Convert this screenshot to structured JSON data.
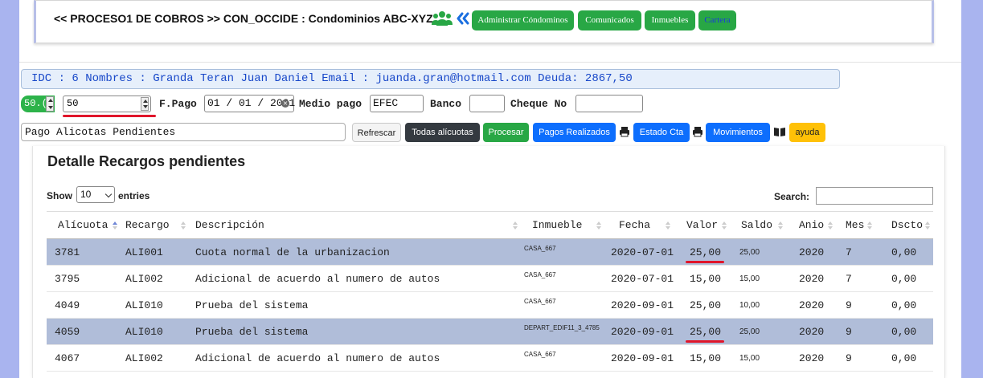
{
  "header": {
    "title": "<< PROCESO1 DE COBROS >> CON_OCCIDE : Condominios ABC-XYZ.",
    "buttons": [
      "Administrar Cóndominos",
      "Comunicados",
      "Inmuebles",
      "Cartera"
    ]
  },
  "info": {
    "text": "IDC : 6 Nombres : Granda Teran Juan Daniel Email : juanda.gran@hotmail.com Deuda: 2867,50"
  },
  "form": {
    "green_spin_value": "50.(",
    "amount_value": "50",
    "fpago_label": "F.Pago",
    "fpago_value": "01 / 01 / 2021",
    "medio_label": "Medio pago",
    "medio_value": "EFEC",
    "banco_label": "Banco",
    "banco_value": "",
    "cheque_label": "Cheque No",
    "cheque_value": "",
    "concept_value": "Pago Alicotas Pendientes"
  },
  "actions": {
    "refrescar": "Refrescar",
    "todas": "Todas alícuotas",
    "procesar": "Procesar",
    "pagos": "Pagos Realizados",
    "estado": "Estado Cta",
    "movimientos": "Movimientos",
    "ayuda": "ayuda"
  },
  "panel": {
    "title": "Detalle Recargos pendientes",
    "show_label": "Show",
    "entries_value": "10",
    "entries_label": "entries",
    "search_label": "Search:",
    "search_value": ""
  },
  "table": {
    "columns": [
      "Alícuota",
      "Recargo",
      "Descripción",
      "Inmueble",
      "Fecha",
      "Valor",
      "Saldo",
      "Anio",
      "Mes",
      "Dscto"
    ],
    "rows": [
      {
        "alicuota": "3781",
        "recargo": "ALI001",
        "descripcion": "Cuota normal de la urbanizacion",
        "inmueble": "CASA_667",
        "fecha": "2020-07-01",
        "valor": "25,00",
        "saldo": "25,00",
        "anio": "2020",
        "mes": "7",
        "dscto": "0,00",
        "selected": true
      },
      {
        "alicuota": "3795",
        "recargo": "ALI002",
        "descripcion": "Adicional de acuerdo al numero de autos",
        "inmueble": "CASA_667",
        "fecha": "2020-07-01",
        "valor": "15,00",
        "saldo": "15,00",
        "anio": "2020",
        "mes": "7",
        "dscto": "0,00",
        "selected": false
      },
      {
        "alicuota": "4049",
        "recargo": "ALI010",
        "descripcion": "Prueba del sistema",
        "inmueble": "CASA_667",
        "fecha": "2020-09-01",
        "valor": "25,00",
        "saldo": "10,00",
        "anio": "2020",
        "mes": "9",
        "dscto": "0,00",
        "selected": false
      },
      {
        "alicuota": "4059",
        "recargo": "ALI010",
        "descripcion": "Prueba del sistema",
        "inmueble": "DEPART_EDIF11_3_4785",
        "fecha": "2020-09-01",
        "valor": "25,00",
        "saldo": "25,00",
        "anio": "2020",
        "mes": "9",
        "dscto": "0,00",
        "selected": true
      },
      {
        "alicuota": "4067",
        "recargo": "ALI002",
        "descripcion": "Adicional de acuerdo al numero de autos",
        "inmueble": "CASA_667",
        "fecha": "2020-09-01",
        "valor": "15,00",
        "saldo": "15,00",
        "anio": "2020",
        "mes": "9",
        "dscto": "0,00",
        "selected": false
      }
    ]
  },
  "colors": {
    "green": "#28a745",
    "blue": "#0d6efd",
    "dark": "#343a40",
    "yellow": "#ffc107",
    "selected_row": "#b0bdd9",
    "info_text": "#1747c9",
    "annotation_red": "#e0162b"
  },
  "icons": [
    "users-icon",
    "double-chevron-left-icon",
    "print-icon",
    "book-icon",
    "clear-icon",
    "sort-icon"
  ]
}
